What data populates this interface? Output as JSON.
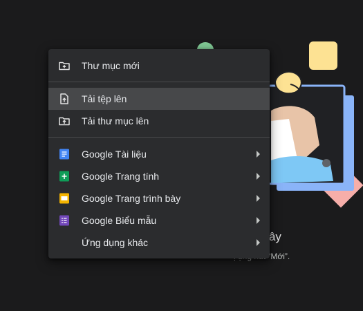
{
  "menu": {
    "items": [
      {
        "label": "Thư mục mới",
        "icon": "new-folder-icon"
      },
      {
        "label": "Tải tệp lên",
        "icon": "file-upload-icon"
      },
      {
        "label": "Tải thư mục lên",
        "icon": "folder-upload-icon"
      },
      {
        "label": "Google Tài liệu",
        "icon": "google-docs-icon"
      },
      {
        "label": "Google Trang tính",
        "icon": "google-sheets-icon"
      },
      {
        "label": "Google Trang trình bày",
        "icon": "google-slides-icon"
      },
      {
        "label": "Google Biểu mẫu",
        "icon": "google-forms-icon"
      },
      {
        "label": "Ứng dụng khác",
        "icon": "more-apps-icon"
      }
    ]
  },
  "empty_state": {
    "title": "ệp ở đây",
    "subtitle": "ị       ụng nút “Mới”."
  },
  "colors": {
    "background": "#1b1b1c",
    "menu": "#2b2c2e",
    "highlight": "#47484a",
    "docs": "#4285f4",
    "sheets": "#0f9d58",
    "slides": "#f4b400",
    "forms": "#7248b9"
  }
}
